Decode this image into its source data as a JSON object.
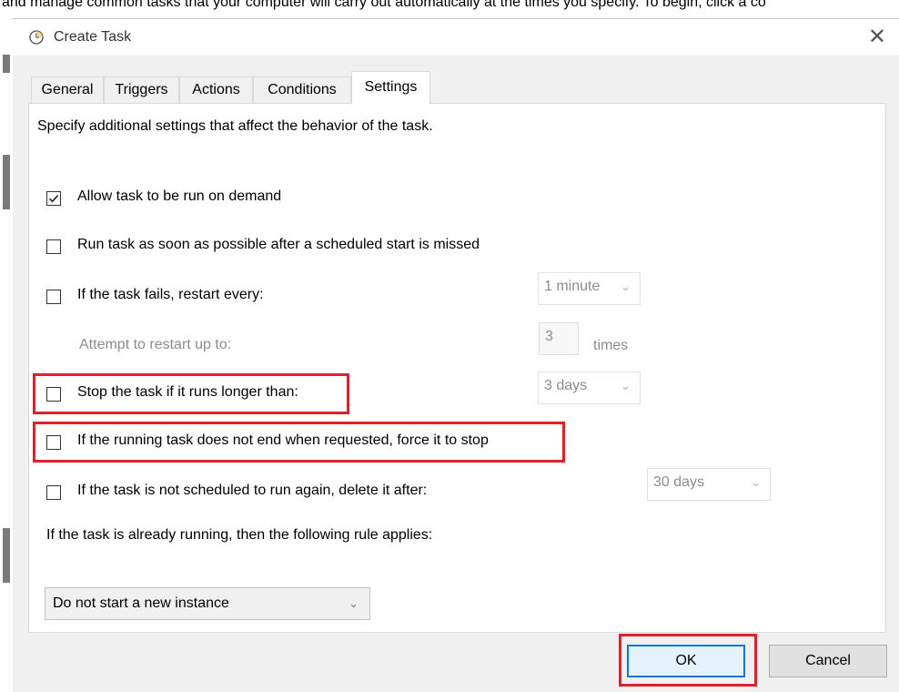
{
  "background_window": {
    "instruction_text": "and manage common tasks that your computer will carry out automatically at the times you specify. To begin, click a co"
  },
  "dialog": {
    "title": "Create Task",
    "close_glyph": "✕"
  },
  "tabs": [
    {
      "label": "General",
      "active": false
    },
    {
      "label": "Triggers",
      "active": false
    },
    {
      "label": "Actions",
      "active": false
    },
    {
      "label": "Conditions",
      "active": false
    },
    {
      "label": "Settings",
      "active": true
    }
  ],
  "settings": {
    "description": "Specify additional settings that affect the behavior of the task.",
    "allow_on_demand": {
      "label": "Allow task to be run on demand",
      "checked": true
    },
    "run_asap": {
      "label": "Run task as soon as possible after a scheduled start is missed",
      "checked": false
    },
    "restart_on_fail": {
      "label": "If the task fails, restart every:",
      "checked": false,
      "interval": "1 minute"
    },
    "attempt_restart": {
      "label": "Attempt to restart up to:",
      "value": "3",
      "unit": "times"
    },
    "stop_if_longer": {
      "label": "Stop the task if it runs longer than:",
      "checked": false,
      "duration": "3 days"
    },
    "force_stop": {
      "label": "If the running task does not end when requested, force it to stop",
      "checked": false
    },
    "delete_if_not_scheduled": {
      "label": "If the task is not scheduled to run again, delete it after:",
      "checked": false,
      "duration": "30 days"
    },
    "running_rule_label": "If the task is already running, then the following rule applies:",
    "running_rule_value": "Do not start a new instance"
  },
  "buttons": {
    "ok": "OK",
    "cancel": "Cancel"
  },
  "icons": {
    "chevron": "⌄"
  },
  "colors": {
    "highlight": "#e0212b",
    "default_button_border": "#0078d7"
  }
}
